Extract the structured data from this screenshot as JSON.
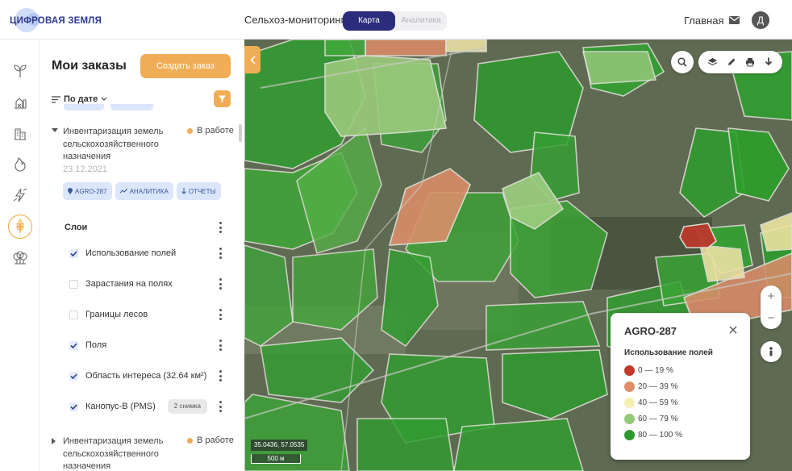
{
  "header": {
    "logo_text": "ЦИФРОВАЯ ЗЕМЛЯ",
    "app_title": "Сельхоз-мониторинг",
    "tabs": [
      {
        "label": "Карта",
        "active": true
      },
      {
        "label": "Аналитика",
        "active": false
      }
    ],
    "home_link": "Главная",
    "mail_icon": "mail-icon",
    "avatar_letter": "Д"
  },
  "rail": {
    "icons": [
      "sprout-icon",
      "farm-icon",
      "buildings-icon",
      "fire-icon",
      "lightning-icon",
      "wheat-icon",
      "forest-icon"
    ],
    "active_icon": "wheat-icon",
    "accent": "#f0a63a"
  },
  "panel": {
    "title": "Мои заказы",
    "create_button": "Создать заказ",
    "sort_label": "По дате",
    "orders": [
      {
        "title": "Инвентаризация земель сельскохозяйственного назначения",
        "status": "В работе",
        "date": "23.12.2021",
        "expanded": true,
        "chips": [
          "AGRO-287",
          "АНАЛИТИКА",
          "ОТЧЕТЫ"
        ]
      },
      {
        "title": "Инвентаризация земель сельскохозяйственного назначения",
        "status": "В работе",
        "expanded": false
      }
    ],
    "layers_title": "Слои",
    "layers": [
      {
        "label": "Использование полей",
        "checked": true
      },
      {
        "label": "Зарастания на полях",
        "checked": false
      },
      {
        "label": "Границы лесов",
        "checked": false
      },
      {
        "label": "Поля",
        "checked": true
      },
      {
        "label": "Область интереса (32.64 км²)",
        "checked": true
      },
      {
        "label": "Канопус-В (PMS)",
        "checked": true,
        "badge": "2 снимка"
      }
    ]
  },
  "map": {
    "coords": "35.0436, 57.0535",
    "scale": "500 м",
    "zoom_in": "+",
    "zoom_out": "−",
    "toolbar_icons": [
      "layers-icon",
      "pencil-icon",
      "print-icon",
      "download-icon"
    ]
  },
  "legend": {
    "title": "AGRO-287",
    "subtitle": "Использование полей",
    "items": [
      {
        "label": "0 — 19 %",
        "color": "#c0392b"
      },
      {
        "label": "20 — 39 %",
        "color": "#e08e6a"
      },
      {
        "label": "40 — 59 %",
        "color": "#f7efb4"
      },
      {
        "label": "60 — 79 %",
        "color": "#95c97a"
      },
      {
        "label": "80 — 100 %",
        "color": "#2e9a2e"
      }
    ]
  }
}
